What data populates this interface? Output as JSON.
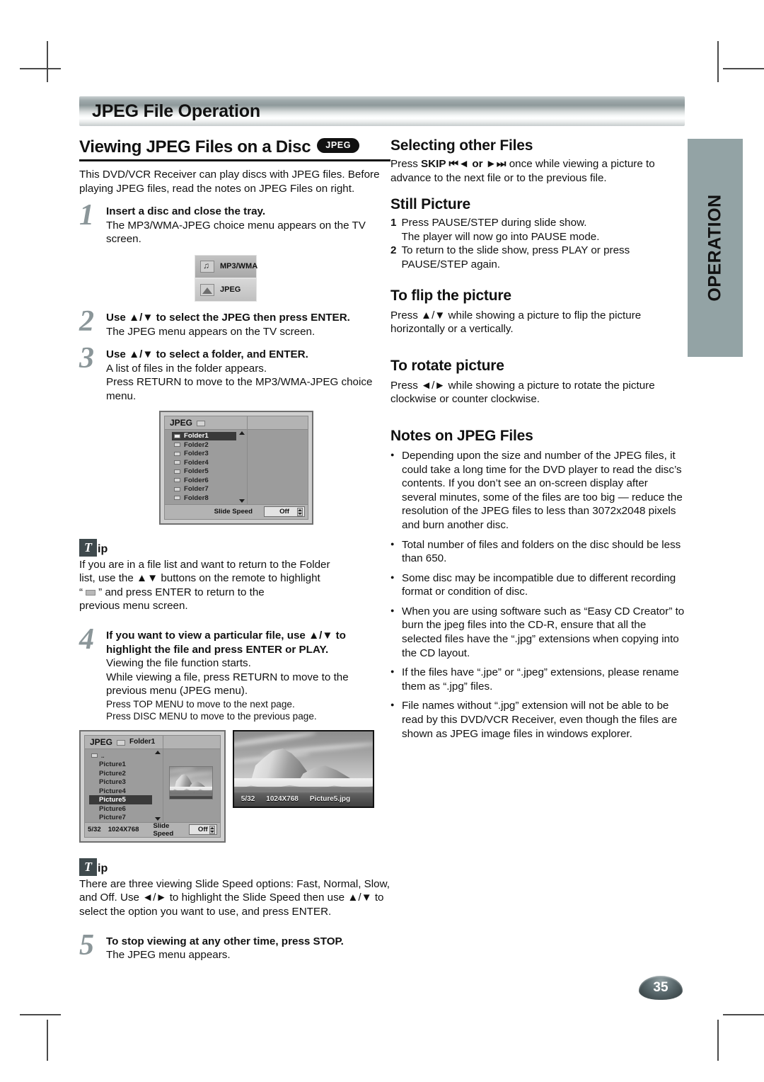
{
  "page": {
    "banner_title": "JPEG File Operation",
    "page_number": "35",
    "side_tab": "OPERATION"
  },
  "left": {
    "heading": "Viewing JPEG Files on a Disc",
    "heading_badge": "JPEG",
    "intro": "This DVD/VCR Receiver can play discs with JPEG files. Before playing JPEG files, read the notes on JPEG Files on right.",
    "steps": [
      {
        "num": "1",
        "title": "Insert a disc and close the tray.",
        "text": "The MP3/WMA-JPEG choice menu appears on the TV screen."
      },
      {
        "num": "2",
        "title": "Use ▲/▼ to select the JPEG then press ENTER.",
        "text": "The JPEG menu appears on the TV screen."
      },
      {
        "num": "3",
        "title": "Use ▲/▼  to select a folder, and ENTER.",
        "text": "A list of files in the folder appears.\nPress RETURN to move to the MP3/WMA-JPEG choice menu."
      },
      {
        "num": "4",
        "title": "If you want to view a particular file, use ▲/▼ to highlight the file and press ENTER or PLAY.",
        "text": "Viewing the file function starts.\nWhile viewing a file, press RETURN to move to the previous menu (JPEG menu).",
        "extra1": "Press TOP MENU to move to the next page.",
        "extra2": "Press DISC MENU to move to the previous page."
      },
      {
        "num": "5",
        "title": "To stop viewing at any other time, press STOP.",
        "text": "The JPEG menu appears."
      }
    ],
    "tip1": {
      "letter": "T",
      "word": "ip",
      "line1": "If you are in a file list and want to return to the Folder",
      "line2": "list, use the ▲▼ buttons on the remote to highlight",
      "line3_pre": "“",
      "line3_post": "” and press ENTER to return to the",
      "line4": "previous menu screen."
    },
    "tip2": {
      "letter": "T",
      "word": "ip",
      "text": "There are three viewing Slide Speed options: Fast, Normal, Slow, and Off. Use ◄/► to highlight the Slide Speed then use ▲/▼ to select the option you want to use, and press ENTER."
    }
  },
  "osd_choice": {
    "rows": [
      {
        "icon": "music-note-icon",
        "label": "MP3/WMA"
      },
      {
        "icon": "picture-icon",
        "label": "JPEG"
      }
    ]
  },
  "osd_folders": {
    "title": "JPEG",
    "items": [
      "Folder1",
      "Folder2",
      "Folder3",
      "Folder4",
      "Folder5",
      "Folder6",
      "Folder7",
      "Folder8"
    ],
    "selected_index": 0,
    "slide_speed_label": "Slide Speed",
    "slide_speed_value": "Off"
  },
  "osd_files": {
    "title": "JPEG",
    "breadcrumb": "Folder1",
    "parent_item": "..",
    "items": [
      "Picture1",
      "Picture2",
      "Picture3",
      "Picture4",
      "Picture5",
      "Picture6",
      "Picture7"
    ],
    "selected_index": 4,
    "file_index": "5/32",
    "resolution": "1024X768",
    "slide_speed_label": "Slide Speed",
    "slide_speed_value": "Off"
  },
  "osd_fullscreen": {
    "file_index": "5/32",
    "resolution": "1024X768",
    "filename": "Picture5.jpg"
  },
  "right": {
    "sections": [
      {
        "heading": "Selecting other Files",
        "body_pre": "Press ",
        "body_kw": "SKIP",
        "body_icons": " ⏮◄ or ►⏭ ",
        "body_post": "once while viewing a picture to advance to the next file or to the previous file."
      },
      {
        "heading": "Still Picture",
        "items": [
          {
            "n": "1",
            "text": "Press PAUSE/STEP during slide show.\nThe player will now go into PAUSE mode."
          },
          {
            "n": "2",
            "text": "To return to the slide show, press PLAY or press PAUSE/STEP again."
          }
        ]
      },
      {
        "heading": "To flip the picture",
        "text": "Press ▲/▼ while showing a picture to flip the picture horizontally or a vertically."
      },
      {
        "heading": "To rotate picture",
        "text": "Press ◄/► while showing a picture to rotate the picture clockwise or counter clockwise."
      }
    ],
    "notes_heading": "Notes on JPEG Files",
    "notes": [
      "Depending upon the size and number of the JPEG files, it could take a long time for the DVD player to read the disc’s contents. If you don’t see an on-screen display after several minutes, some of the files are too big — reduce the resolution of the JPEG files to less than 3072x2048 pixels and burn another disc.",
      "Total number of files and folders on the disc should be less than 650.",
      "Some disc may be incompatible due to different recording format or condition of disc.",
      "When you are using software such as “Easy CD Creator” to burn the jpeg files into the CD-R, ensure that all the selected files have the “.jpg” extensions when copying into the CD layout.",
      "If the files have “.jpe” or “.jpeg” extensions, please rename them as “.jpg” files.",
      "File names without “.jpg” extension will not be able to be read by this DVD/VCR Receiver, even though the files are shown as JPEG image files in windows explorer."
    ]
  }
}
